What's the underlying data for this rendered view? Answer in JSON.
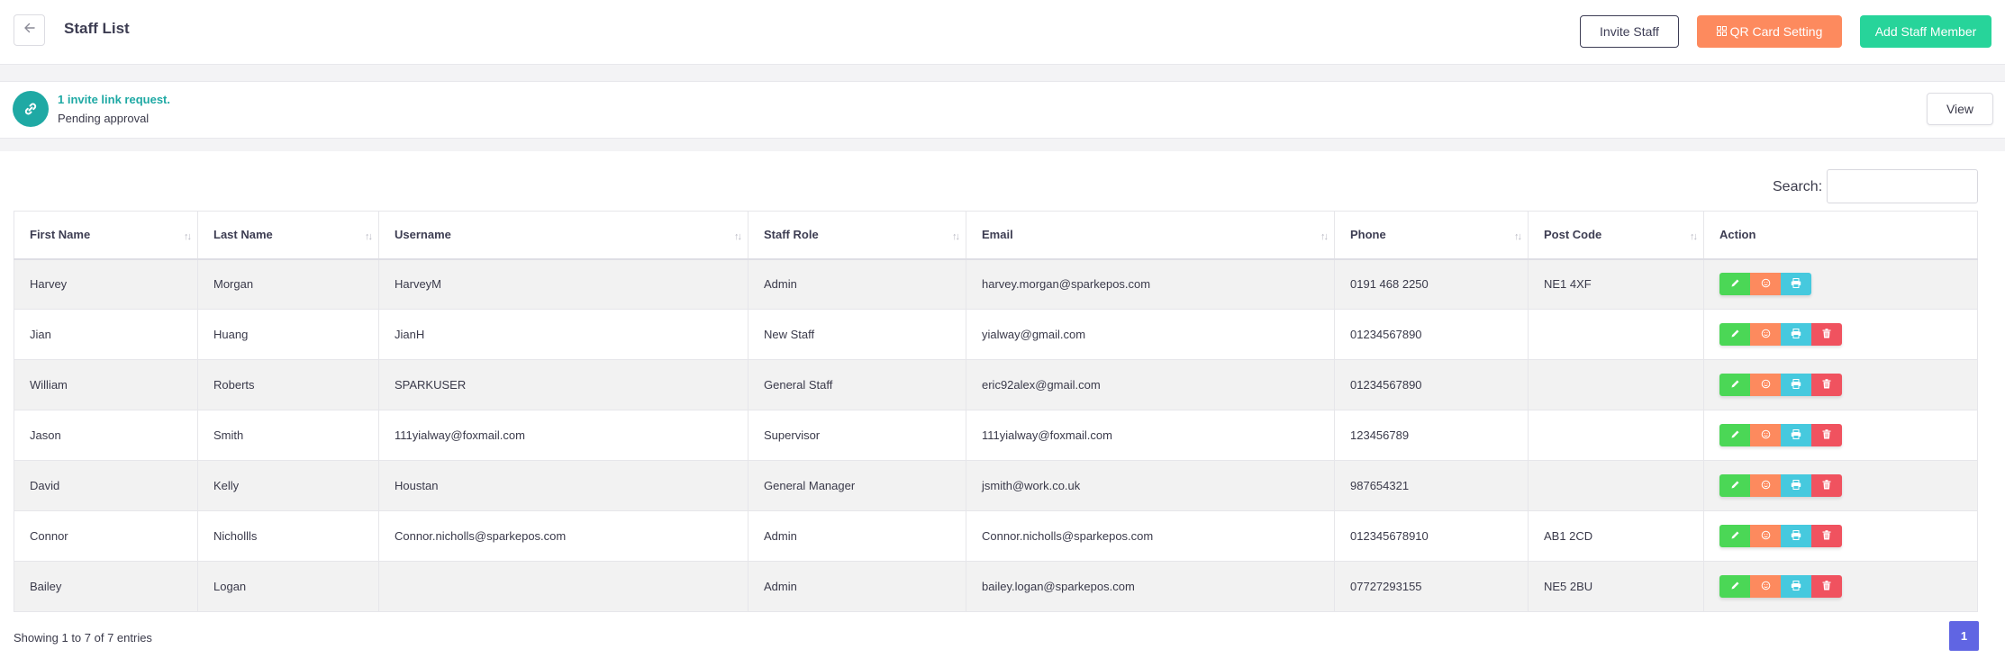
{
  "header": {
    "title": "Staff List",
    "back_icon": "arrow-left-icon",
    "invite_label": "Invite Staff",
    "qr_label": "QR Card Setting",
    "qr_icon": "qr-grid-icon",
    "add_label": "Add Staff Member"
  },
  "notice": {
    "icon": "link-icon",
    "title": "1 invite link request.",
    "subtitle": "Pending approval",
    "view_label": "View"
  },
  "search": {
    "label": "Search:",
    "value": ""
  },
  "table": {
    "columns": [
      "First Name",
      "Last Name",
      "Username",
      "Staff Role",
      "Email",
      "Phone",
      "Post Code",
      "Action"
    ],
    "rows": [
      {
        "first": "Harvey",
        "last": "Morgan",
        "username": "HarveyM",
        "role": "Admin",
        "email": "harvey.morgan@sparkepos.com",
        "phone": "0191 468 2250",
        "postcode": "NE1 4XF",
        "deletable": false
      },
      {
        "first": "Jian",
        "last": "Huang",
        "username": "JianH",
        "role": "New Staff",
        "email": "yialway@gmail.com",
        "phone": "01234567890",
        "postcode": "",
        "deletable": true
      },
      {
        "first": "William",
        "last": "Roberts",
        "username": "SPARKUSER",
        "role": "General Staff",
        "email": "eric92alex@gmail.com",
        "phone": "01234567890",
        "postcode": "",
        "deletable": true
      },
      {
        "first": "Jason",
        "last": "Smith",
        "username": "111yialway@foxmail.com",
        "role": "Supervisor",
        "email": "111yialway@foxmail.com",
        "phone": "123456789",
        "postcode": "",
        "deletable": true
      },
      {
        "first": "David",
        "last": "Kelly",
        "username": "Houstan",
        "role": "General Manager",
        "email": "jsmith@work.co.uk",
        "phone": "987654321",
        "postcode": "",
        "deletable": true
      },
      {
        "first": "Connor",
        "last": "Nichollls",
        "username": "Connor.nicholls@sparkepos.com",
        "role": "Admin",
        "email": "Connor.nicholls@sparkepos.com",
        "phone": "012345678910",
        "postcode": "AB1 2CD",
        "deletable": true
      },
      {
        "first": "Bailey",
        "last": "Logan",
        "username": "",
        "role": "Admin",
        "email": "bailey.logan@sparkepos.com",
        "phone": "07727293155",
        "postcode": "NE5 2BU",
        "deletable": true
      }
    ]
  },
  "footer": {
    "info": "Showing 1 to 7 of 7 entries",
    "page": "1"
  },
  "colors": {
    "teal": "#1fa9a4",
    "orange": "#fd8a5e",
    "green": "#27d49a",
    "edit_green": "#4bd756",
    "print_cyan": "#46c9de",
    "delete_red": "#f0525f",
    "page_purple": "#6065e3"
  }
}
